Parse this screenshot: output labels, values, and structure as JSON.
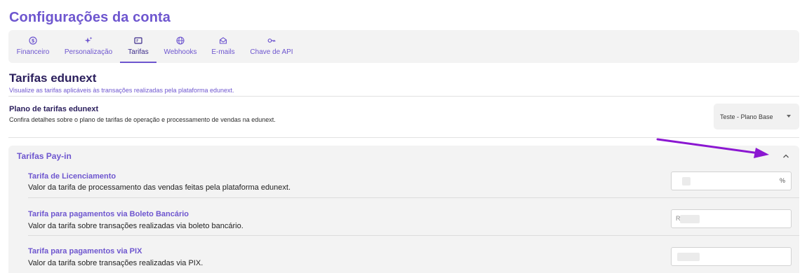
{
  "page": {
    "title": "Configurações da conta"
  },
  "tabs": [
    {
      "label": "Financeiro",
      "icon": "dollar-circle-icon"
    },
    {
      "label": "Personalização",
      "icon": "sparkles-icon"
    },
    {
      "label": "Tarifas",
      "icon": "receipt-icon",
      "active": true
    },
    {
      "label": "Webhooks",
      "icon": "globe-icon"
    },
    {
      "label": "E-mails",
      "icon": "mail-icon"
    },
    {
      "label": "Chave de API",
      "icon": "key-icon"
    }
  ],
  "section": {
    "title": "Tarifas edunext",
    "subtitle": "Visualize as tarifas aplicáveis às transações realizadas pela plataforma edunext."
  },
  "plan": {
    "title": "Plano de tarifas edunext",
    "description": "Confira detalhes sobre o plano de tarifas de operação e processamento de vendas na edunext.",
    "selected": "Teste - Plano Base"
  },
  "payin": {
    "title": "Tarifas Pay-in",
    "rows": [
      {
        "title": "Tarifa de Licenciamento",
        "description": "Valor da tarifa de processamento das vendas feitas pela plataforma edunext.",
        "unit": "%"
      },
      {
        "title": "Tarifa para pagamentos via Boleto Bancário",
        "description": "Valor da tarifa sobre transações realizadas via boleto bancário.",
        "prefix": "R"
      },
      {
        "title": "Tarifa para pagamentos via PIX",
        "description": "Valor da tarifa sobre transações realizadas via PIX."
      }
    ]
  },
  "colors": {
    "accent": "#6e56cf",
    "annotation_arrow": "#8b17d1",
    "heading_dark": "#2a1e5c"
  }
}
